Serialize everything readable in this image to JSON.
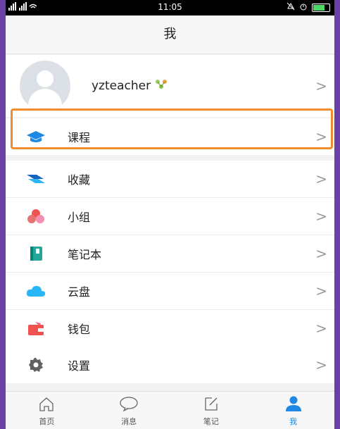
{
  "status_bar": {
    "signal": "ᴴᴳıl ᴴᴳıl",
    "time": "11:05"
  },
  "header": {
    "title": "我"
  },
  "profile": {
    "username": "yzteacher"
  },
  "menu": {
    "course": "课程",
    "favorites": "收藏",
    "group": "小组",
    "notebook": "笔记本",
    "cloud": "云盘",
    "wallet": "钱包",
    "settings": "设置"
  },
  "tabs": [
    {
      "label": "首页",
      "icon": "home-icon"
    },
    {
      "label": "消息",
      "icon": "message-icon"
    },
    {
      "label": "笔记",
      "icon": "note-icon"
    },
    {
      "label": "我",
      "icon": "person-icon"
    }
  ],
  "colors": {
    "highlight": "#f08c2e",
    "accent_blue": "#1e88e5",
    "active_tab": "#1e88e5"
  }
}
